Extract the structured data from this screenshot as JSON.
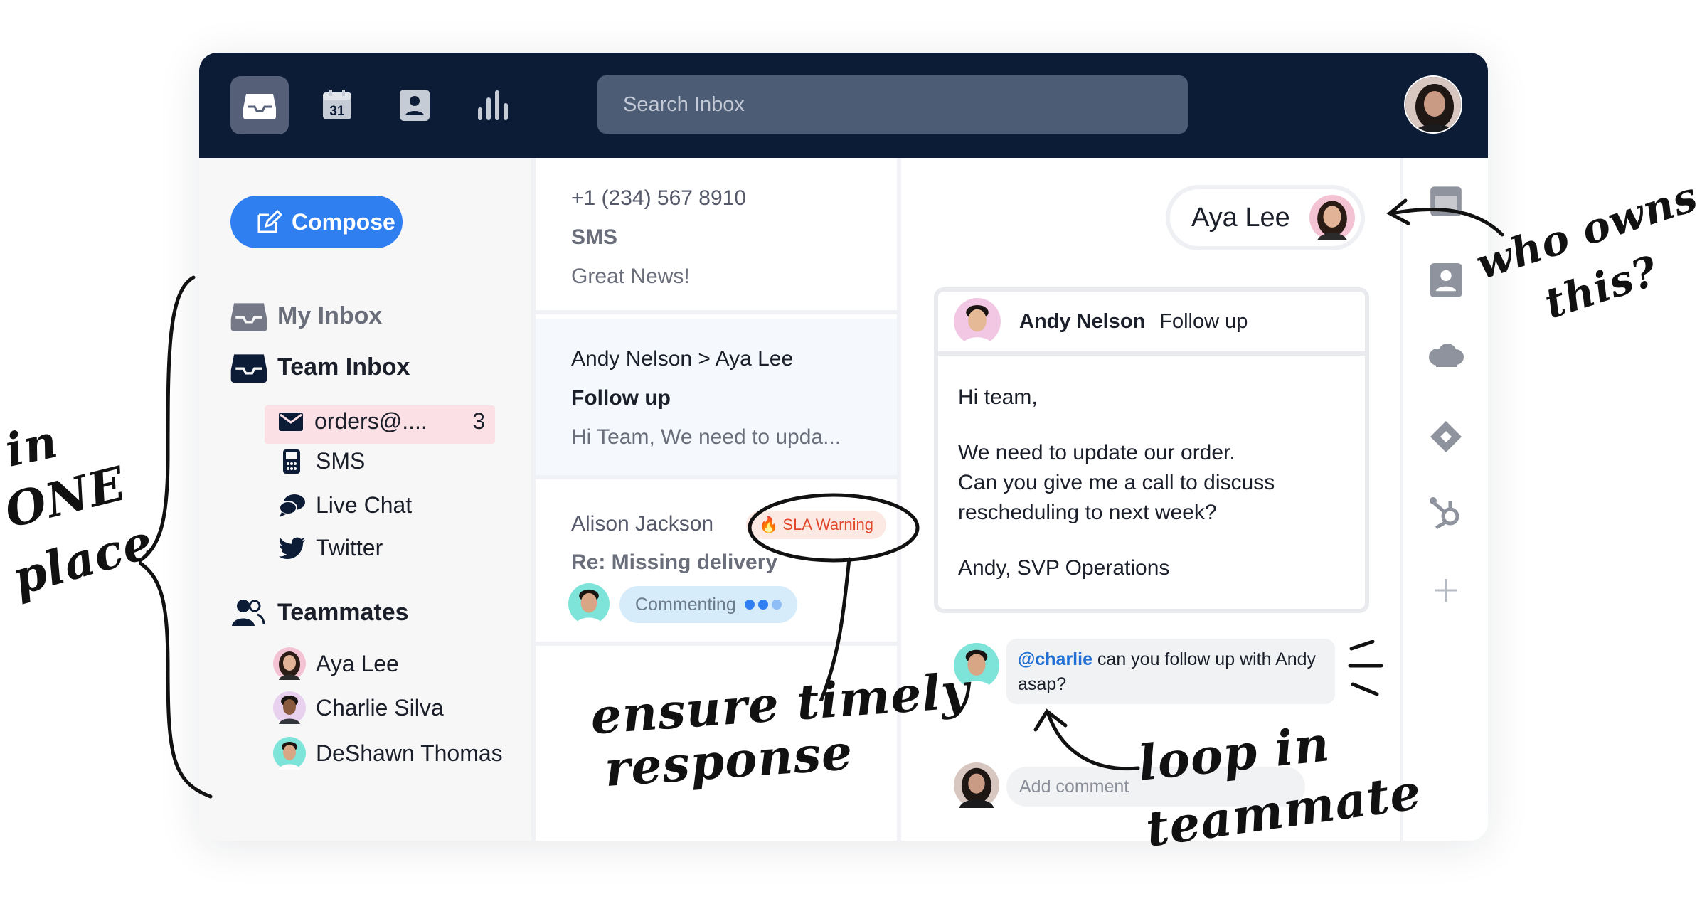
{
  "topbar": {
    "search_placeholder": "Search Inbox",
    "calendar_day": "31"
  },
  "sidebar": {
    "compose_label": "Compose",
    "my_inbox": "My Inbox",
    "team_inbox": "Team Inbox",
    "channels": [
      {
        "label": "orders@....",
        "count": "3",
        "icon": "mail-icon"
      },
      {
        "label": "SMS",
        "icon": "phone-icon"
      },
      {
        "label": "Live Chat",
        "icon": "chat-icon"
      },
      {
        "label": "Twitter",
        "icon": "twitter-icon"
      }
    ],
    "teammates_label": "Teammates",
    "teammates": [
      {
        "name": "Aya Lee"
      },
      {
        "name": "Charlie Silva"
      },
      {
        "name": "DeShawn Thomas"
      }
    ]
  },
  "conversations": [
    {
      "from": "+1 (234) 567 8910",
      "subject": "SMS",
      "preview": "Great News!"
    },
    {
      "from": "Andy Nelson > Aya Lee",
      "subject": "Follow up",
      "preview": "Hi Team, We need to upda..."
    },
    {
      "from": "Alison Jackson",
      "subject": "Re: Missing delivery",
      "sla": "SLA Warning",
      "status": "Commenting"
    }
  ],
  "detail": {
    "assignee": "Aya Lee",
    "message": {
      "sender": "Andy Nelson",
      "subject": "Follow up",
      "greeting": "Hi team,",
      "line1": "We need to update our order.",
      "line2": "Can you give me a call to discuss",
      "line3": "rescheduling to next week?",
      "signature": "Andy, SVP Operations"
    },
    "comment": {
      "mention": "@charlie",
      "text_a": " can you follow up with Andy",
      "text_b": "asap?"
    },
    "add_comment_placeholder": "Add comment"
  },
  "annotations": {
    "in_one_place_1": "in",
    "in_one_place_2": "ONE",
    "in_one_place_3": "place",
    "who_owns_1": "who owns",
    "who_owns_2": "this?",
    "ensure_1": "ensure timely",
    "ensure_2": "response",
    "loop_1": "loop in",
    "loop_2": "teammate"
  },
  "colors": {
    "topbar": "#0c1b36",
    "accent": "#2f7ff0",
    "badge": "#fbe0e6",
    "sla": "#e2462a"
  }
}
